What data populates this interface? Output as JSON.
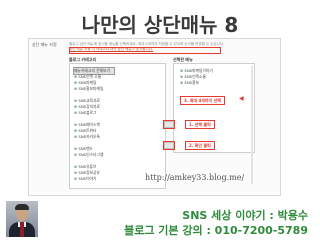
{
  "title": "나만의 상단매뉴 8",
  "screenshot": {
    "menu_label": "상단 메뉴 지정",
    "description_lines": [
      "블로그 상단 메뉴에 표시할 메뉴를 선택하세요. 최대 4개까지 지정할 수 있으며 순서를 변경할 수 있습니다.",
      "상단 메뉴 사용 시 카테고리 대신 상단 메뉴가 표시됩니다."
    ],
    "left_header": "블로그 카테고리",
    "right_header": "선택한 메뉴",
    "left_items": [
      "메뉴카테고리 전체보기",
      "SNS인맥 소통",
      "SNS마케팅",
      "SNS홍보마케팅",
      "SNS교육자료",
      "SNS강의자료",
      "SNS블로그",
      "SNS페이스북",
      "SNS트위터",
      "SNS카카오톡",
      "SNS밴드",
      "SNS인스타그램",
      "SNS유튜브",
      "SNS정보공유",
      "SNS이야기"
    ],
    "right_items": [
      "SNS마케팅이야기",
      "SNS인맥소통",
      "SNS홍보"
    ],
    "callout_max": "3. 최대 4개까지 선택",
    "callout_select": "1. 선택 클릭",
    "callout_confirm": "2. 확인 클릭"
  },
  "watermark_url": "http://amkey33.blog.me/",
  "footer": {
    "line1": "SNS  세상 이야기 : 박용수",
    "line2": "블로그 기본 강의 : 010-7200-5789"
  }
}
